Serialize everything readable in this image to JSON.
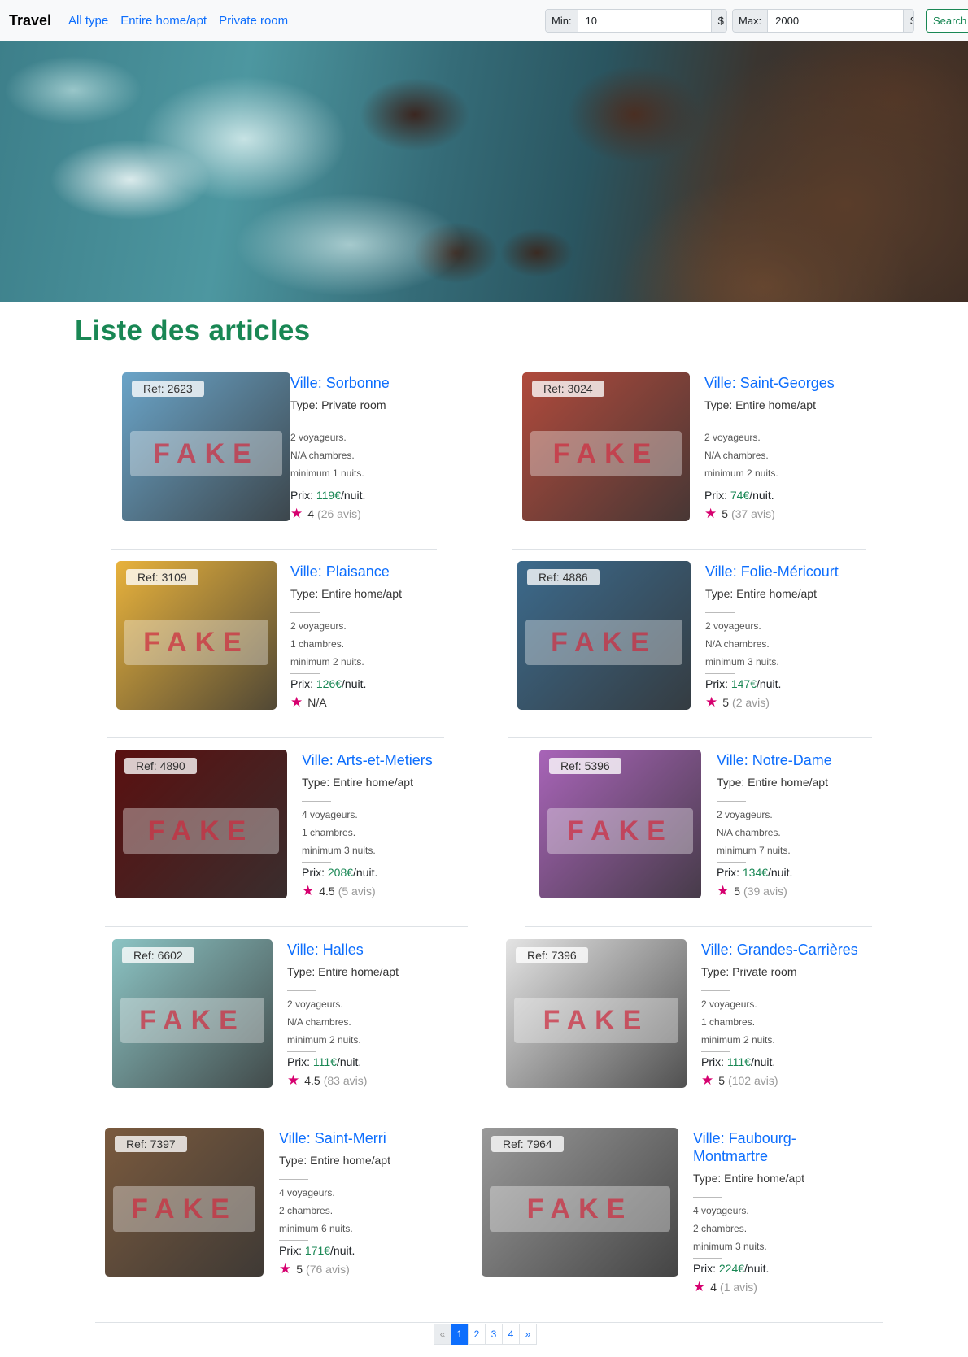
{
  "navbar": {
    "brand": "Travel",
    "links": [
      "All type",
      "Entire home/apt",
      "Private room"
    ],
    "min_label": "Min:",
    "min_value": "10",
    "max_label": "Max:",
    "max_value": "2000",
    "currency": "$",
    "search_label": "Search"
  },
  "page_title": "Liste des articles",
  "articles": [
    {
      "ref": "Ref: 2623",
      "fake": "FAKE",
      "ville": "Ville: Sorbonne",
      "type": "Type: Private room",
      "voyageurs": "2 voyageurs.",
      "chambres": "N/A chambres.",
      "minimum": "minimum 1 nuits.",
      "prix_label": "Prix: ",
      "prix": "119€",
      "prix_unit": "/nuit.",
      "rating": "4",
      "avis": "(26 avis)",
      "theme": "#6aa4c8"
    },
    {
      "ref": "Ref: 3024",
      "fake": "FAKE",
      "ville": "Ville: Saint-Georges",
      "type": "Type: Entire home/apt",
      "voyageurs": "2 voyageurs.",
      "chambres": "N/A chambres.",
      "minimum": "minimum 2 nuits.",
      "prix_label": "Prix: ",
      "prix": "74€",
      "prix_unit": "/nuit.",
      "rating": "5",
      "avis": "(37 avis)",
      "theme": "#b04a3c"
    },
    {
      "ref": "Ref: 3109",
      "fake": "FAKE",
      "ville": "Ville: Plaisance",
      "type": "Type: Entire home/apt",
      "voyageurs": "2 voyageurs.",
      "chambres": "1 chambres.",
      "minimum": "minimum 2 nuits.",
      "prix_label": "Prix: ",
      "prix": "126€",
      "prix_unit": "/nuit.",
      "rating": "N/A",
      "avis": "",
      "theme": "#e8b23c"
    },
    {
      "ref": "Ref: 4886",
      "fake": "FAKE",
      "ville": "Ville: Folie-Méricourt",
      "type": "Type: Entire home/apt",
      "voyageurs": "2 voyageurs.",
      "chambres": "N/A chambres.",
      "minimum": "minimum 3 nuits.",
      "prix_label": "Prix: ",
      "prix": "147€",
      "prix_unit": "/nuit.",
      "rating": "5",
      "avis": "(2 avis)",
      "theme": "#3c6a8c"
    },
    {
      "ref": "Ref: 4890",
      "fake": "FAKE",
      "ville": "Ville: Arts-et-Metiers",
      "type": "Type: Entire home/apt",
      "voyageurs": "4 voyageurs.",
      "chambres": "1 chambres.",
      "minimum": "minimum 3 nuits.",
      "prix_label": "Prix: ",
      "prix": "208€",
      "prix_unit": "/nuit.",
      "rating": "4.5",
      "avis": "(5 avis)",
      "theme": "#5a1010"
    },
    {
      "ref": "Ref: 5396",
      "fake": "FAKE",
      "ville": "Ville: Notre-Dame",
      "type": "Type: Entire home/apt",
      "voyageurs": "2 voyageurs.",
      "chambres": "N/A chambres.",
      "minimum": "minimum 7 nuits.",
      "prix_label": "Prix: ",
      "prix": "134€",
      "prix_unit": "/nuit.",
      "rating": "5",
      "avis": "(39 avis)",
      "theme": "#a864b8"
    },
    {
      "ref": "Ref: 6602",
      "fake": "FAKE",
      "ville": "Ville: Halles",
      "type": "Type: Entire home/apt",
      "voyageurs": "2 voyageurs.",
      "chambres": "N/A chambres.",
      "minimum": "minimum 2 nuits.",
      "prix_label": "Prix: ",
      "prix": "111€",
      "prix_unit": "/nuit.",
      "rating": "4.5",
      "avis": "(83 avis)",
      "theme": "#8cc4c4"
    },
    {
      "ref": "Ref: 7396",
      "fake": "FAKE",
      "ville": "Ville: Grandes-Carrières",
      "type": "Type: Private room",
      "voyageurs": "2 voyageurs.",
      "chambres": "1 chambres.",
      "minimum": "minimum 2 nuits.",
      "prix_label": "Prix: ",
      "prix": "111€",
      "prix_unit": "/nuit.",
      "rating": "5",
      "avis": "(102 avis)",
      "theme": "#e4e4e4"
    },
    {
      "ref": "Ref: 7397",
      "fake": "FAKE",
      "ville": "Ville: Saint-Merri",
      "type": "Type: Entire home/apt",
      "voyageurs": "4 voyageurs.",
      "chambres": "2 chambres.",
      "minimum": "minimum 6 nuits.",
      "prix_label": "Prix: ",
      "prix": "171€",
      "prix_unit": "/nuit.",
      "rating": "5",
      "avis": "(76 avis)",
      "theme": "#7a5a3e"
    },
    {
      "ref": "Ref: 7964",
      "fake": "FAKE",
      "ville": "Ville: Faubourg-Montmartre",
      "type": "Type: Entire home/apt",
      "voyageurs": "4 voyageurs.",
      "chambres": "2 chambres.",
      "minimum": "minimum 3 nuits.",
      "prix_label": "Prix: ",
      "prix": "224€",
      "prix_unit": "/nuit.",
      "rating": "4",
      "avis": "(1 avis)",
      "theme": "#9a9a9a"
    }
  ],
  "pagination": {
    "prev": "«",
    "pages": [
      "1",
      "2",
      "3",
      "4"
    ],
    "next": "»",
    "active": "1"
  },
  "colors": {
    "accent": "#0d6efd",
    "title": "#198754",
    "star": "#d6006f",
    "price": "#198754"
  }
}
